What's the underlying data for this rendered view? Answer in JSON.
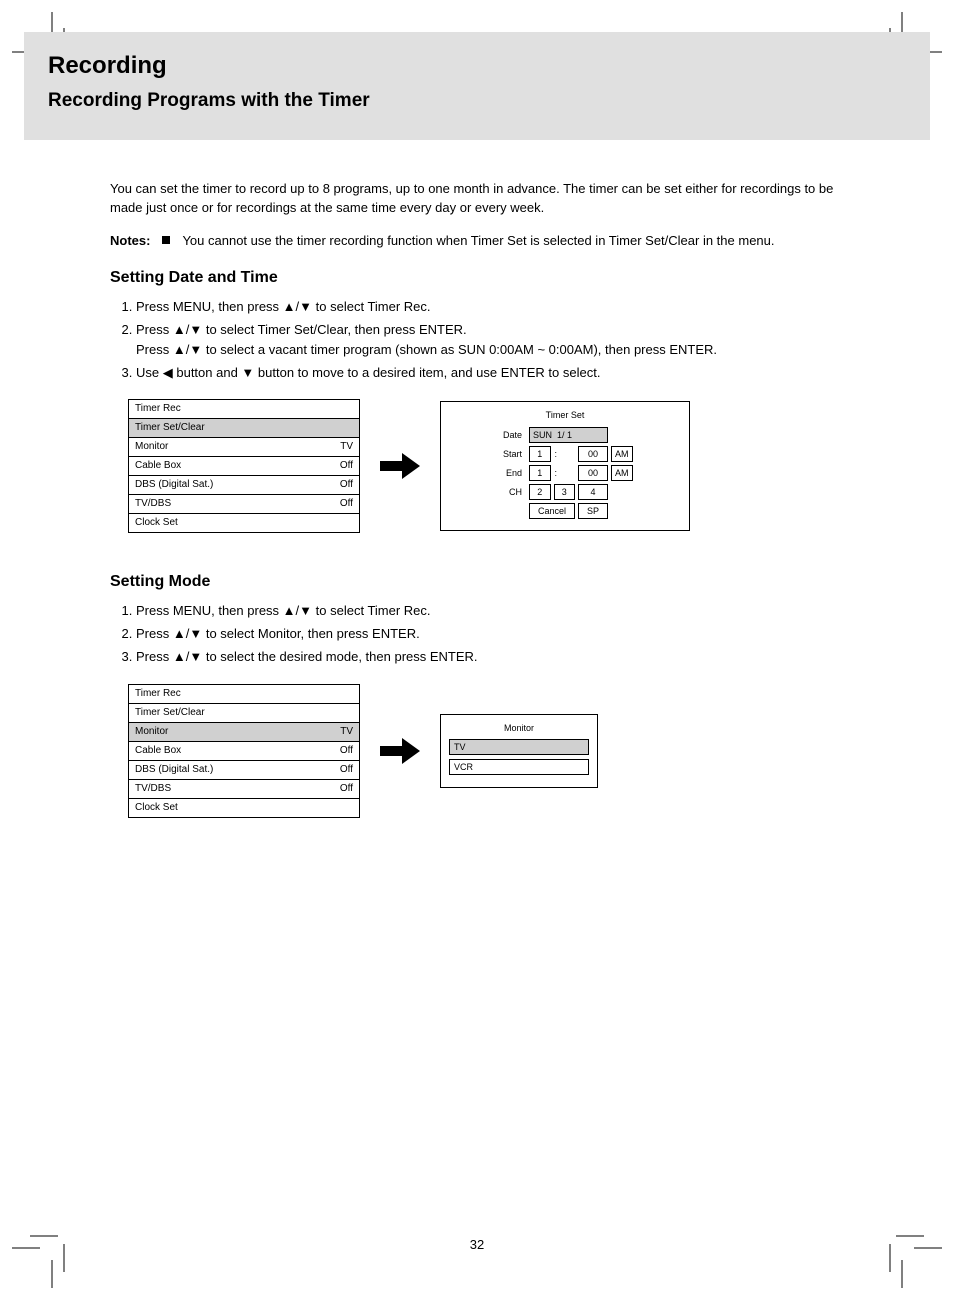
{
  "header": {
    "title": "Recording",
    "subtitle": "Recording Programs with the Timer"
  },
  "intro": "You can set the timer to record up to 8 programs, up to one month in advance. The timer can be set either for recordings to be made just once or for recordings at the same time every day or every week.",
  "note": {
    "label": "Notes:",
    "bullet_text": "You cannot use the timer recording function when Timer Set is selected in Timer Set/Clear in the menu."
  },
  "section1": {
    "heading": "Setting Date and Time",
    "step1_pre": "Press MENU, then press ",
    "step1_post": " to select Timer Rec.",
    "step2_pre": "Press ",
    "step2_mid": " to select Timer Set/Clear, then press ENTER.",
    "step2_line2_a": "Press ",
    "step2_line2_b": " to select a vacant timer program (shown as SUN 0:00AM ~ 0:00AM), then press ENTER.",
    "step3_pre": "Use ",
    "step3_left": " button and ",
    "step3_down": " button to move to a desired item, and use ENTER to select."
  },
  "menu1": {
    "items": [
      {
        "label": "Timer Rec",
        "value": ""
      },
      {
        "label": "Timer Set/Clear",
        "value": "",
        "selected": true
      },
      {
        "label": "Monitor",
        "value": "TV"
      },
      {
        "label": "Cable Box",
        "value": "Off"
      },
      {
        "label": "DBS (Digital Sat.)",
        "value": "Off"
      },
      {
        "label": "TV/DBS",
        "value": "Off"
      },
      {
        "label": "Clock Set",
        "value": ""
      }
    ]
  },
  "timer_set_panel": {
    "caption": "Timer Set",
    "rows": [
      {
        "lbl": "Date",
        "cells": [
          {
            "v": "SUN",
            "sel": true
          },
          {
            "v": "1/ 1",
            "sel": true
          }
        ]
      },
      {
        "lbl": "Start",
        "cells": [
          {
            "v": "1",
            "sel": false
          },
          {
            "v": ":",
            "bare": true
          },
          {
            "v": "00"
          },
          {
            "v": "AM"
          }
        ]
      },
      {
        "lbl": "End",
        "cells": [
          {
            "v": "1"
          },
          {
            "v": ":",
            "bare": true
          },
          {
            "v": "00"
          },
          {
            "v": "AM"
          }
        ]
      }
    ],
    "ch_row": {
      "lbl": "CH",
      "cells": [
        {
          "v": "2"
        },
        {
          "v": "3"
        },
        {
          "v": "4"
        }
      ]
    },
    "bottom": [
      {
        "v": "Cancel"
      },
      {
        "v": "SP"
      }
    ]
  },
  "section2": {
    "heading": "Setting Mode",
    "step1_pre": "Press MENU, then press ",
    "step1_post": " to select Timer Rec.",
    "step2_pre": "Press ",
    "step2_post": " to select Monitor, then press ENTER.",
    "step3_pre": "Press ",
    "step3_post": " to select the desired mode, then press ENTER."
  },
  "menu2": {
    "items": [
      {
        "label": "Timer Rec",
        "value": ""
      },
      {
        "label": "Timer Set/Clear",
        "value": ""
      },
      {
        "label": "Monitor",
        "value": "TV",
        "selected": true
      },
      {
        "label": "Cable Box",
        "value": "Off"
      },
      {
        "label": "DBS (Digital Sat.)",
        "value": "Off"
      },
      {
        "label": "TV/DBS",
        "value": "Off"
      },
      {
        "label": "Clock Set",
        "value": ""
      }
    ]
  },
  "mode_panel": {
    "caption": "Monitor",
    "options": [
      {
        "label": "TV",
        "selected": true
      },
      {
        "label": "VCR",
        "selected": false
      }
    ]
  },
  "page_num": "32"
}
